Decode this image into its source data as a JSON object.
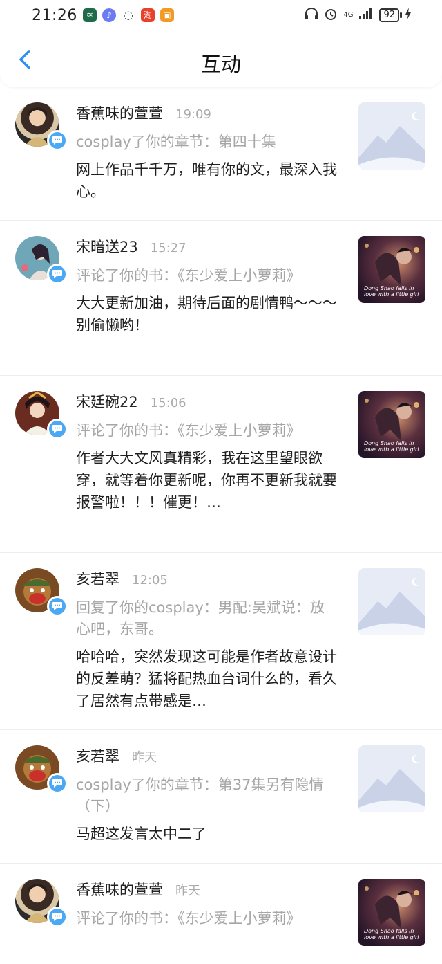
{
  "status_bar": {
    "time": "21:26",
    "network": "4G",
    "battery": "92"
  },
  "header": {
    "title": "互动"
  },
  "items": [
    {
      "name": "香蕉味的萱萱",
      "time": "19:09",
      "action": "cosplay了你的章节：第四十集",
      "comment": "网上作品千千万，唯有你的文，最深入我心。",
      "thumb": "placeholder"
    },
    {
      "name": "宋暗送23",
      "time": "15:27",
      "action": "评论了你的书：《东少爱上小萝莉》",
      "comment": "大大更新加油，期待后面的剧情鸭～～～别偷懒哟！",
      "thumb": "cover",
      "cover_caption": "Dong Shao falls in love with a little girl"
    },
    {
      "name": "宋廷碗22",
      "time": "15:06",
      "action": "评论了你的书：《东少爱上小萝莉》",
      "comment": "作者大大文风真精彩，我在这里望眼欲穿，就等着你更新呢，你再不更新我就要报警啦！！！催更！…",
      "thumb": "cover",
      "cover_caption": "Dong Shao falls in love with a little girl"
    },
    {
      "name": "亥若翠",
      "time": "12:05",
      "action": "回复了你的cosplay：男配:吴斌说：放心吧，东哥。",
      "comment": "哈哈哈，突然发现这可能是作者故意设计的反差萌？猛将配热血台词什么的，看久了居然有点带感是…",
      "thumb": "placeholder"
    },
    {
      "name": "亥若翠",
      "time": "昨天",
      "action": "cosplay了你的章节：第37集另有隐情（下）",
      "comment": "马超这发言太中二了",
      "thumb": "placeholder"
    },
    {
      "name": "香蕉味的萱萱",
      "time": "昨天",
      "action": "评论了你的书：《东少爱上小萝莉》",
      "comment": "",
      "thumb": "cover",
      "cover_caption": "Dong Shao falls in love with a little girl"
    }
  ],
  "colors": {
    "badge": "#4aa8f5",
    "back_arrow": "#2f8ef0",
    "meta": "#a6a6a6"
  },
  "icons": {
    "back": "chevron-left-icon",
    "badge": "comment-bubble-icon"
  }
}
